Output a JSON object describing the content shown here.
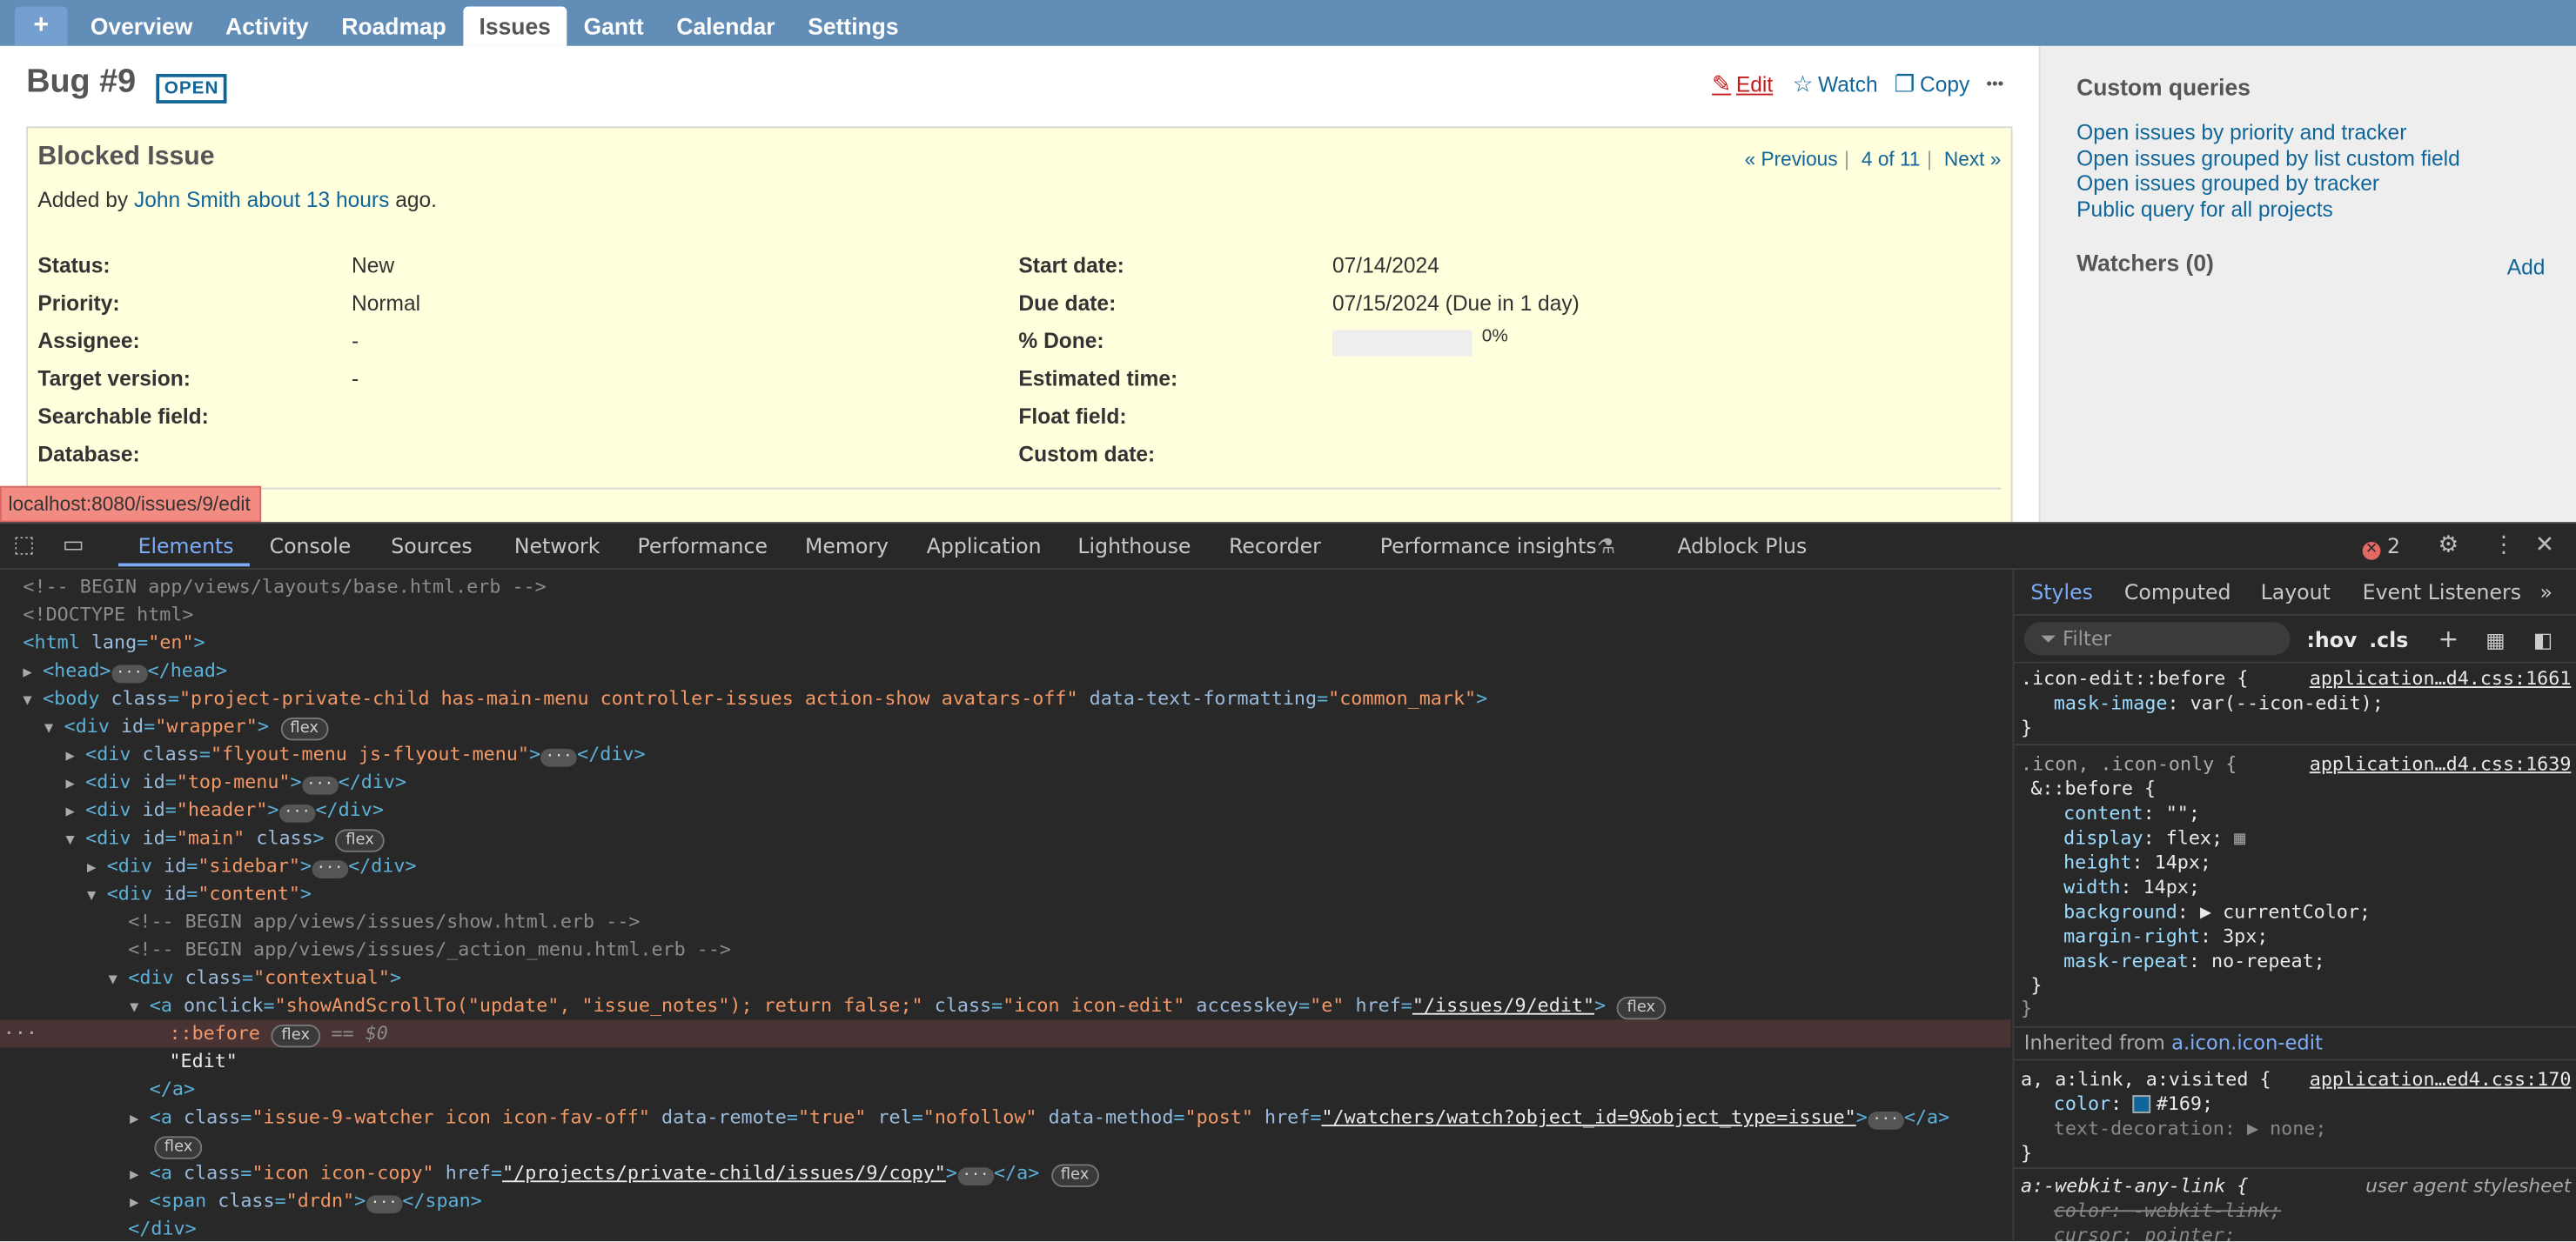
{
  "nav": {
    "plus": "+",
    "items": [
      "Overview",
      "Activity",
      "Roadmap",
      "Issues",
      "Gantt",
      "Calendar",
      "Settings"
    ],
    "selected": "Issues"
  },
  "issue": {
    "title": "Bug #9",
    "status_badge": "OPEN",
    "actions": {
      "edit": "Edit",
      "watch": "Watch",
      "copy": "Copy",
      "more": "•••"
    },
    "subject": "Blocked Issue",
    "added_prefix": "Added by",
    "author": "John Smith",
    "age": "about 13 hours",
    "added_suffix": "ago.",
    "pager": {
      "prev": "« Previous",
      "position": "4 of 11",
      "next": "Next »",
      "sep": "|"
    },
    "left_attrs": [
      {
        "label": "Status:",
        "value": "New"
      },
      {
        "label": "Priority:",
        "value": "Normal"
      },
      {
        "label": "Assignee:",
        "value": "-"
      },
      {
        "label": "Target version:",
        "value": "-"
      },
      {
        "label": "Searchable field:",
        "value": ""
      },
      {
        "label": "Database:",
        "value": ""
      }
    ],
    "right_attrs": [
      {
        "label": "Start date:",
        "value": "07/14/2024"
      },
      {
        "label": "Due date:",
        "value": "07/15/2024 (Due in 1 day)"
      },
      {
        "label": "% Done:",
        "value": "0%"
      },
      {
        "label": "Estimated time:",
        "value": ""
      },
      {
        "label": "Float field:",
        "value": ""
      },
      {
        "label": "Custom date:",
        "value": ""
      }
    ],
    "done_fraction": 0
  },
  "sidebar": {
    "queries_title": "Custom queries",
    "queries": [
      "Open issues by priority and tracker",
      "Open issues grouped by list custom field",
      "Open issues grouped by tracker",
      "Public query for all projects"
    ],
    "watchers_title": "Watchers (0)",
    "add": "Add"
  },
  "status_url": "localhost:8080/issues/9/edit",
  "devtools": {
    "tabs": [
      "Elements",
      "Console",
      "Sources",
      "Network",
      "Performance",
      "Memory",
      "Application",
      "Lighthouse",
      "Recorder",
      "Performance insights",
      "Adblock Plus"
    ],
    "selected_tab": "Elements",
    "error_count": "2",
    "dom_lines": [
      "<!-- BEGIN app/views/layouts/base.html.erb -->",
      "<!DOCTYPE html>"
    ],
    "styles_tabs": [
      "Styles",
      "Computed",
      "Layout",
      "Event Listeners",
      "»"
    ],
    "filter_placeholder": "Filter",
    "hov": ":hov",
    "cls": ".cls",
    "inherited_label": "Inherited from",
    "inherited_from": "a.icon.icon-edit",
    "user_agent": "user agent stylesheet"
  }
}
